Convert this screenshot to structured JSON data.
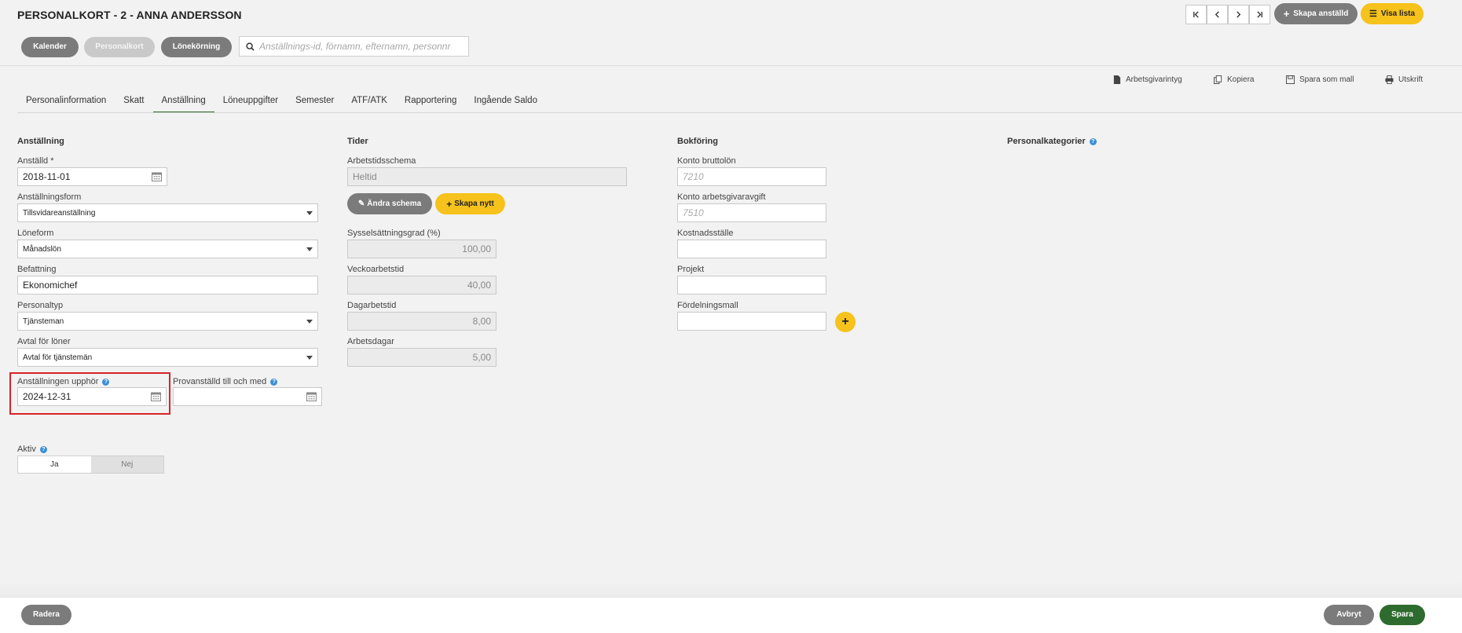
{
  "header": {
    "title": "PERSONALKORT - 2 - ANNA ANDERSSON",
    "nav_buttons": [
      "Kalender",
      "Personalkort",
      "Lönekörning"
    ],
    "search_placeholder": "Anställnings-id, förnamn, efternamn, personnr",
    "create_employee": "Skapa anställd",
    "show_list": "Visa lista"
  },
  "actions": {
    "employer_cert": "Arbetsgivarintyg",
    "copy": "Kopiera",
    "save_template": "Spara som mall",
    "print": "Utskrift"
  },
  "tabs": [
    "Personalinformation",
    "Skatt",
    "Anställning",
    "Löneuppgifter",
    "Semester",
    "ATF/ATK",
    "Rapportering",
    "Ingående Saldo"
  ],
  "employment": {
    "title": "Anställning",
    "employed_label": "Anställd *",
    "employed_value": "2018-11-01",
    "form_label": "Anställningsform",
    "form_value": "Tillsvidareanställning",
    "salary_form_label": "Löneform",
    "salary_form_value": "Månadslön",
    "position_label": "Befattning",
    "position_value": "Ekonomichef",
    "staff_type_label": "Personaltyp",
    "staff_type_value": "Tjänsteman",
    "agreement_label": "Avtal för löner",
    "agreement_value": "Avtal för tjänstemän",
    "end_label": "Anställningen upphör",
    "end_value": "2024-12-31",
    "probation_label": "Provanställd till och med",
    "probation_value": "",
    "active_label": "Aktiv",
    "active_yes": "Ja",
    "active_no": "Nej"
  },
  "times": {
    "title": "Tider",
    "schedule_label": "Arbetstidsschema",
    "schedule_value": "Heltid",
    "change_schedule": "Ändra schema",
    "create_new": "Skapa nytt",
    "occupancy_label": "Sysselsättningsgrad (%)",
    "occupancy_value": "100,00",
    "weekly_label": "Veckoarbetstid",
    "weekly_value": "40,00",
    "daily_label": "Dagarbetstid",
    "daily_value": "8,00",
    "workdays_label": "Arbetsdagar",
    "workdays_value": "5,00"
  },
  "accounting": {
    "title": "Bokföring",
    "gross_label": "Konto bruttolön",
    "gross_placeholder": "7210",
    "fee_label": "Konto arbetsgivaravgift",
    "fee_placeholder": "7510",
    "cost_center_label": "Kostnadsställe",
    "project_label": "Projekt",
    "distribution_label": "Fördelningsmall"
  },
  "categories": {
    "title": "Personalkategorier"
  },
  "footer": {
    "delete": "Radera",
    "cancel": "Avbryt",
    "save": "Spara"
  }
}
